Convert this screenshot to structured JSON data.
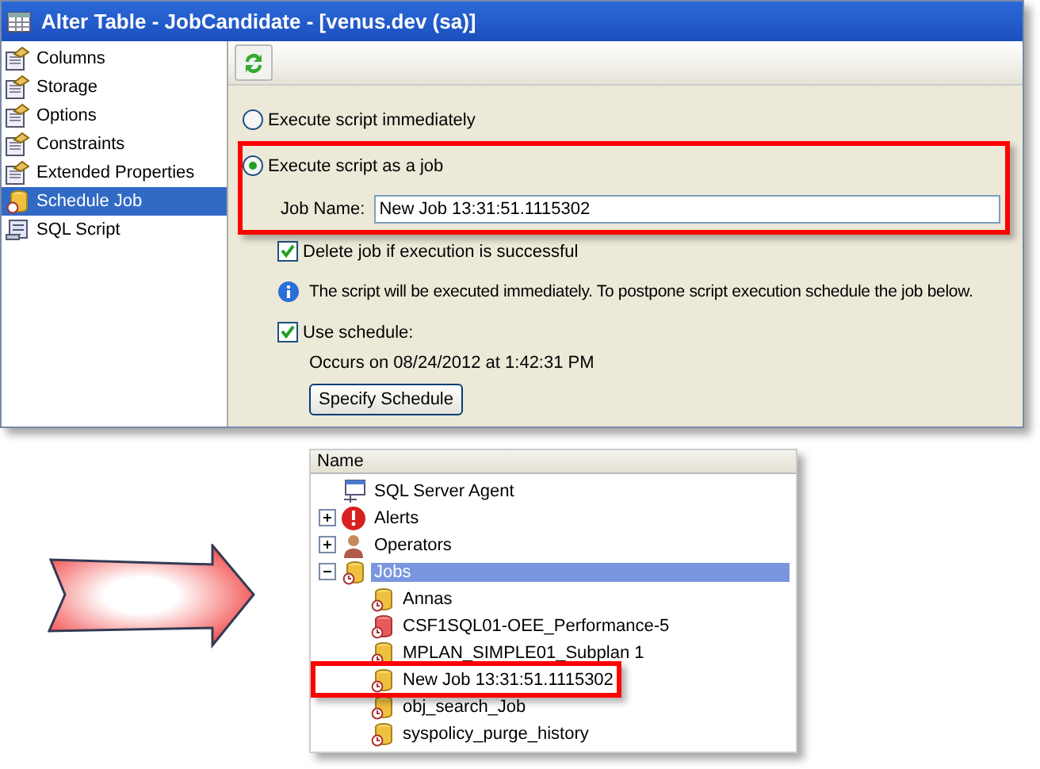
{
  "window": {
    "title": "Alter Table - JobCandidate - [venus.dev (sa)]"
  },
  "sidebar": {
    "items": [
      {
        "label": "Columns",
        "kind": "page",
        "selected": false
      },
      {
        "label": "Storage",
        "kind": "page",
        "selected": false
      },
      {
        "label": "Options",
        "kind": "page",
        "selected": false
      },
      {
        "label": "Constraints",
        "kind": "page",
        "selected": false
      },
      {
        "label": "Extended Properties",
        "kind": "page",
        "selected": false
      },
      {
        "label": "Schedule Job",
        "kind": "job",
        "selected": true
      },
      {
        "label": "SQL Script",
        "kind": "script",
        "selected": false
      }
    ]
  },
  "execution": {
    "options": [
      {
        "label": "Execute script immediately",
        "selected": false,
        "highlighted": false
      },
      {
        "label": "Execute script as a job",
        "selected": true,
        "highlighted": true
      }
    ],
    "job_name": {
      "label": "Job Name:",
      "value": "New Job 13:31:51.1115302"
    },
    "delete_job": {
      "label": "Delete job if execution is successful",
      "checked": true
    },
    "info": "The script will be executed immediately. To postpone script execution schedule the job below.",
    "use_schedule": {
      "label": "Use schedule:",
      "checked": true
    },
    "schedule_text": "Occurs on 08/24/2012 at 1:42:31 PM",
    "button": "Specify Schedule"
  },
  "tree": {
    "column": "Name",
    "nodes": [
      {
        "label": "SQL Server Agent",
        "kind": "agent",
        "selected": false,
        "highlighted": false
      },
      {
        "label": "Alerts",
        "kind": "alert",
        "expanded": false,
        "selected": false,
        "highlighted": false
      },
      {
        "label": "Operators",
        "kind": "operator",
        "expanded": false,
        "selected": false,
        "highlighted": false
      },
      {
        "label": "Jobs",
        "kind": "jobs",
        "expanded": true,
        "selected": true,
        "highlighted": false,
        "children": [
          {
            "label": "Annas",
            "kind": "job",
            "selected": false,
            "highlighted": false
          },
          {
            "label": "CSF1SQL01-OEE_Performance-5",
            "kind": "job-failed",
            "selected": false,
            "highlighted": false
          },
          {
            "label": "MPLAN_SIMPLE01_Subplan 1",
            "kind": "job",
            "selected": false,
            "highlighted": false
          },
          {
            "label": "New Job 13:31:51.1115302",
            "kind": "job",
            "selected": false,
            "highlighted": true
          },
          {
            "label": "obj_search_Job",
            "kind": "job",
            "selected": false,
            "highlighted": false
          },
          {
            "label": "syspolicy_purge_history",
            "kind": "job",
            "selected": false,
            "highlighted": false
          }
        ]
      }
    ]
  }
}
